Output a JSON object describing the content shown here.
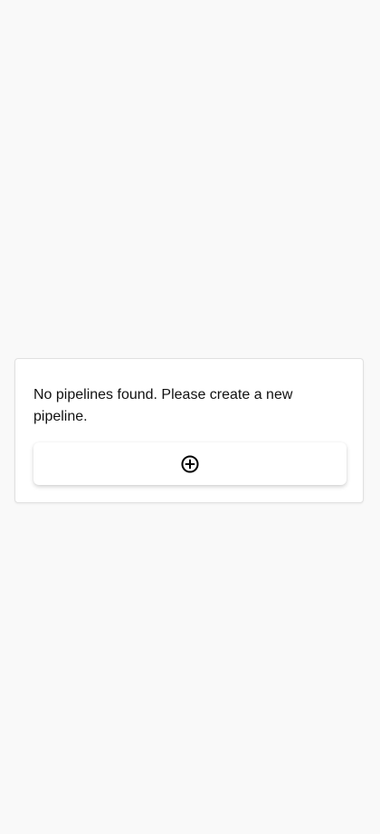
{
  "empty_state": {
    "message": "No pipelines found. Please create a new pipeline.",
    "create_button": {
      "icon": "plus-circle-icon"
    }
  },
  "colors": {
    "background": "#f9f9f9",
    "card": "#ffffff",
    "text": "#111111",
    "icon": "#000000"
  }
}
